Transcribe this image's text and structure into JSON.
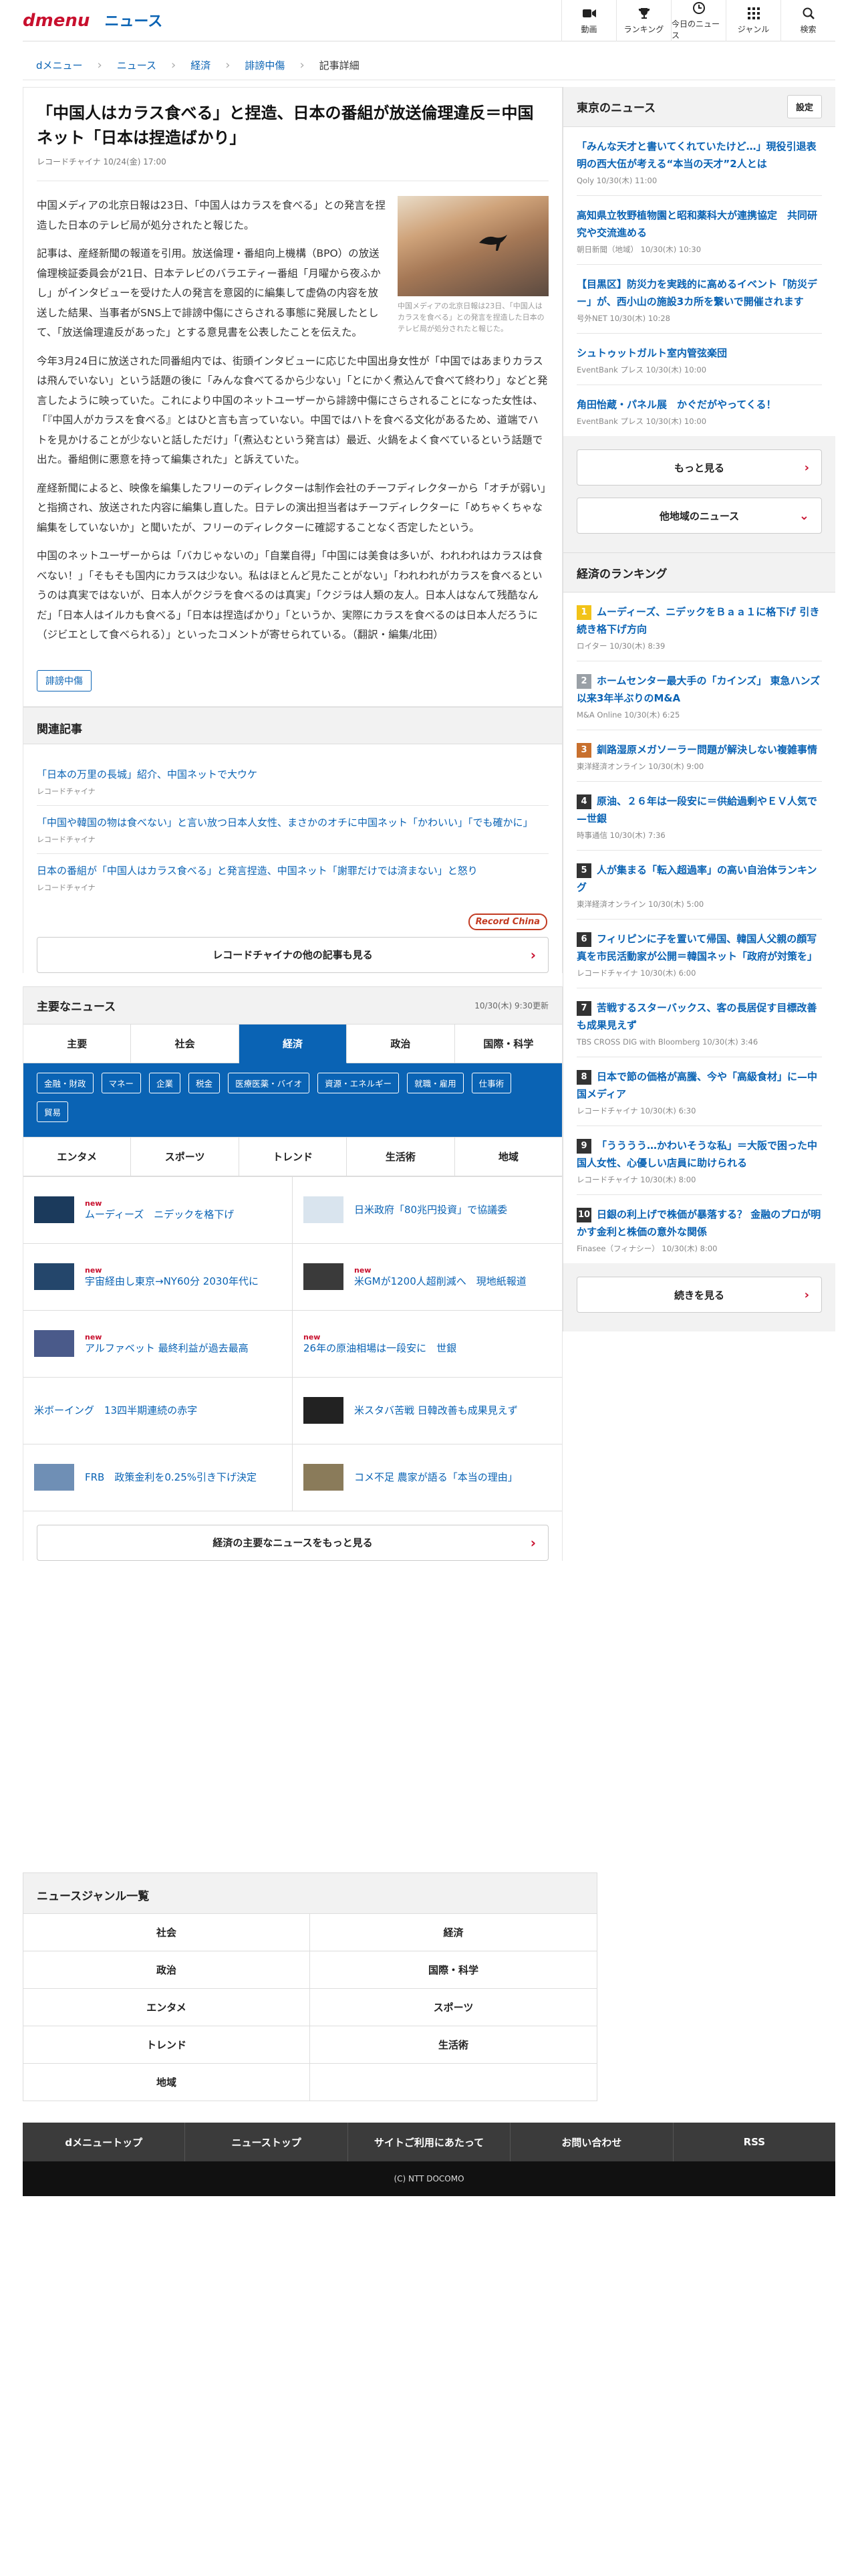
{
  "header": {
    "logo_d": "dmenu",
    "logo_news": "ニュース",
    "nav": [
      {
        "label": "動画",
        "icon": "video-icon"
      },
      {
        "label": "ランキング",
        "icon": "trophy-icon"
      },
      {
        "label": "今日のニュース",
        "icon": "clock-icon"
      },
      {
        "label": "ジャンル",
        "icon": "grid-icon"
      },
      {
        "label": "検索",
        "icon": "search-icon"
      }
    ]
  },
  "breadcrumb": [
    "dメニュー",
    "ニュース",
    "経済",
    "誹謗中傷",
    "記事詳細"
  ],
  "article": {
    "title": "「中国人はカラス食べる」と捏造、日本の番組が放送倫理違反＝中国ネット「日本は捏造ばかり」",
    "meta": "レコードチャイナ 10/24(金) 17:00",
    "caption": "中国メディアの北京日報は23日、「中国人はカラスを食べる」との発言を捏造した日本のテレビ局が処分されたと報じた。",
    "paragraphs": [
      "中国メディアの北京日報は23日、「中国人はカラスを食べる」との発言を捏造した日本のテレビ局が処分されたと報じた。",
      "記事は、産経新聞の報道を引用。放送倫理・番組向上機構（BPO）の放送倫理検証委員会が21日、日本テレビのバラエティー番組「月曜から夜ふかし」がインタビューを受けた人の発言を意図的に編集して虚偽の内容を放送した結果、当事者がSNS上で誹謗中傷にさらされる事態に発展したとして、「放送倫理違反があった」とする意見書を公表したことを伝えた。",
      "今年3月24日に放送された同番組内では、街頭インタビューに応じた中国出身女性が「中国ではあまりカラスは飛んでいない」という話題の後に「みんな食べてるから少ない」「とにかく煮込んで食べて終わり」などと発言したように映っていた。これにより中国のネットユーザーから誹謗中傷にさらされることになった女性は、「『中国人がカラスを食べる』とはひと言も言っていない。中国ではハトを食べる文化があるため、道端でハトを見かけることが少ないと話しただけ」「(煮込むという発言は）最近、火鍋をよく食べているという話題で出た。番組側に悪意を持って編集された」と訴えていた。",
      "産経新聞によると、映像を編集したフリーのディレクターは制作会社のチーフディレクターから「オチが弱い」と指摘され、放送された内容に編集し直した。日テレの演出担当者はチーフディレクターに「めちゃくちゃな編集をしていないか」と聞いたが、フリーのディレクターに確認することなく否定したという。",
      "中国のネットユーザーからは「バカじゃないの」「自業自得」「中国には美食は多いが、われわれはカラスは食べない！」「そもそも国内にカラスは少ない。私はほとんど見たことがない」「われわれがカラスを食べるというのは真実ではないが、日本人がクジラを食べるのは真実」「クジラは人類の友人。日本人はなんて残酷なんだ」「日本人はイルカも食べる」「日本は捏造ばかり」「というか、実際にカラスを食べるのは日本人だろうに（ジビエとして食べられる）」といったコメントが寄せられている。（翻訳・編集/北田）"
    ],
    "tag": "誹謗中傷"
  },
  "related": {
    "heading": "関連記事",
    "items": [
      {
        "title": "「日本の万里の長城」紹介、中国ネットで大ウケ",
        "source": "レコードチャイナ"
      },
      {
        "title": "「中国や韓国の物は食べない」と言い放つ日本人女性、まさかのオチに中国ネット「かわいい」「でも確かに」",
        "source": "レコードチャイナ"
      },
      {
        "title": "日本の番組が「中国人はカラス食べる」と発言捏造、中国ネット「謝罪だけでは済まない」と怒り",
        "source": "レコードチャイナ"
      }
    ],
    "provider_logo": "Record China",
    "more_label": "レコードチャイナの他の記事も見る"
  },
  "major": {
    "heading": "主要なニュース",
    "updated": "10/30(木) 9:30更新",
    "tabs_row1": [
      "主要",
      "社会",
      "経済",
      "政治",
      "国際・科学"
    ],
    "subtags": [
      "金融・財政",
      "マネー",
      "企業",
      "税金",
      "医療医薬・バイオ",
      "資源・エネルギー",
      "就職・雇用",
      "仕事術",
      "貿易"
    ],
    "tabs_row2": [
      "エンタメ",
      "スポーツ",
      "トレンド",
      "生活術",
      "地域"
    ],
    "news": [
      {
        "new": "new",
        "title": "ムーディーズ　ニデックを格下げ",
        "thumb": "#1b3a5c"
      },
      {
        "new": "",
        "title": "日米政府「80兆円投資」で協議委",
        "thumb": "#d9e4ee"
      },
      {
        "new": "new",
        "title": "宇宙経由し東京→NY60分 2030年代に",
        "thumb": "#24466b"
      },
      {
        "new": "new",
        "title": "米GMが1200人超削減へ　現地紙報道",
        "thumb": "#3a3a3a"
      },
      {
        "new": "new",
        "title": "アルファベット 最終利益が過去最高",
        "thumb": "#4a5a8a"
      },
      {
        "new": "new",
        "title": "26年の原油相場は一段安に　世銀",
        "thumb": ""
      },
      {
        "new": "",
        "title": "米ボーイング　13四半期連続の赤字",
        "thumb": ""
      },
      {
        "new": "",
        "title": "米スタバ苦戦 日韓改善も成果見えず",
        "thumb": "#222222"
      },
      {
        "new": "",
        "title": "FRB　政策金利を0.25%引き下げ決定",
        "thumb": "#6f8fb5"
      },
      {
        "new": "",
        "title": "コメ不足 農家が語る「本当の理由」",
        "thumb": "#8a7b5a"
      }
    ],
    "more_label": "経済の主要なニュースをもっと見る"
  },
  "tokyo": {
    "heading": "東京のニュース",
    "settings": "設定",
    "items": [
      {
        "title": "「みんな天才と書いてくれていたけど…」現役引退表明の西大伍が考える“本当の天才”2人とは",
        "source": "Qoly 10/30(木) 11:00"
      },
      {
        "title": "高知県立牧野植物園と昭和薬科大が連携協定　共同研究や交流進める",
        "source": "朝日新聞（地域） 10/30(木) 10:30"
      },
      {
        "title": "【目黒区】防災力を実践的に高めるイベント「防災デー」が、西小山の施設3カ所を繋いで開催されます",
        "source": "号外NET 10/30(木) 10:28"
      },
      {
        "title": "シュトゥットガルト室内管弦楽団",
        "source": "EventBank プレス 10/30(木) 10:00"
      },
      {
        "title": "角田怡蔵・パネル展　かぐだがやってくる！",
        "source": "EventBank プレス 10/30(木) 10:00"
      }
    ],
    "more_label": "もっと見る",
    "other_label": "他地域のニュース"
  },
  "ranking": {
    "heading": "経済のランキング",
    "colors": [
      "#f2c318",
      "#9aa0a6",
      "#c8702e"
    ],
    "default_color": "#333333",
    "items": [
      {
        "n": "1",
        "title": "ムーディーズ、ニデックをＢａａ１に格下げ 引き続き格下げ方向",
        "source": "ロイター 10/30(木) 8:39"
      },
      {
        "n": "2",
        "title": "ホームセンター最大手の「カインズ」 東急ハンズ以来3年半ぶりのM&A",
        "source": "M&A Online 10/30(木) 6:25"
      },
      {
        "n": "3",
        "title": "釧路湿原メガソーラー問題が解決しない複雑事情",
        "source": "東洋経済オンライン 10/30(木) 9:00"
      },
      {
        "n": "4",
        "title": "原油、２６年は一段安に＝供給過剰やＥＶ人気で—世銀",
        "source": "時事通信 10/30(木) 7:36"
      },
      {
        "n": "5",
        "title": "人が集まる「転入超過率」の高い自治体ランキング",
        "source": "東洋経済オンライン 10/30(木) 5:00"
      },
      {
        "n": "6",
        "title": "フィリピンに子を置いて帰国、韓国人父親の顔写真を市民活動家が公開＝韓国ネット「政府が対策を」",
        "source": "レコードチャイナ 10/30(木) 6:00"
      },
      {
        "n": "7",
        "title": "苦戦するスターバックス、客の長居促す目標改善も成果見えず",
        "source": "TBS CROSS DIG with Bloomberg 10/30(木) 3:46"
      },
      {
        "n": "8",
        "title": "日本で節の価格が高騰、今や「高級食材」に—中国メディア",
        "source": "レコードチャイナ 10/30(木) 6:30"
      },
      {
        "n": "9",
        "title": "「うううう…かわいそうな私」＝大阪で困った中国人女性、心優しい店員に助けられる",
        "source": "レコードチャイナ 10/30(木) 8:00"
      },
      {
        "n": "10",
        "title": "日銀の利上げで株価が暴落する？ 金融のプロが明かす金利と株価の意外な関係",
        "source": "Finasee（フィナシー） 10/30(木) 8:00"
      }
    ],
    "more_label": "続きを見る"
  },
  "genre": {
    "heading": "ニュースジャンル一覧",
    "items": [
      "社会",
      "経済",
      "政治",
      "国際・科学",
      "エンタメ",
      "スポーツ",
      "トレンド",
      "生活術",
      "地域",
      ""
    ]
  },
  "footer": {
    "nav": [
      "dメニュートップ",
      "ニューストップ",
      "サイトご利用にあたって",
      "お問い合わせ",
      "RSS"
    ],
    "copyright": "(C) NTT DOCOMO"
  }
}
